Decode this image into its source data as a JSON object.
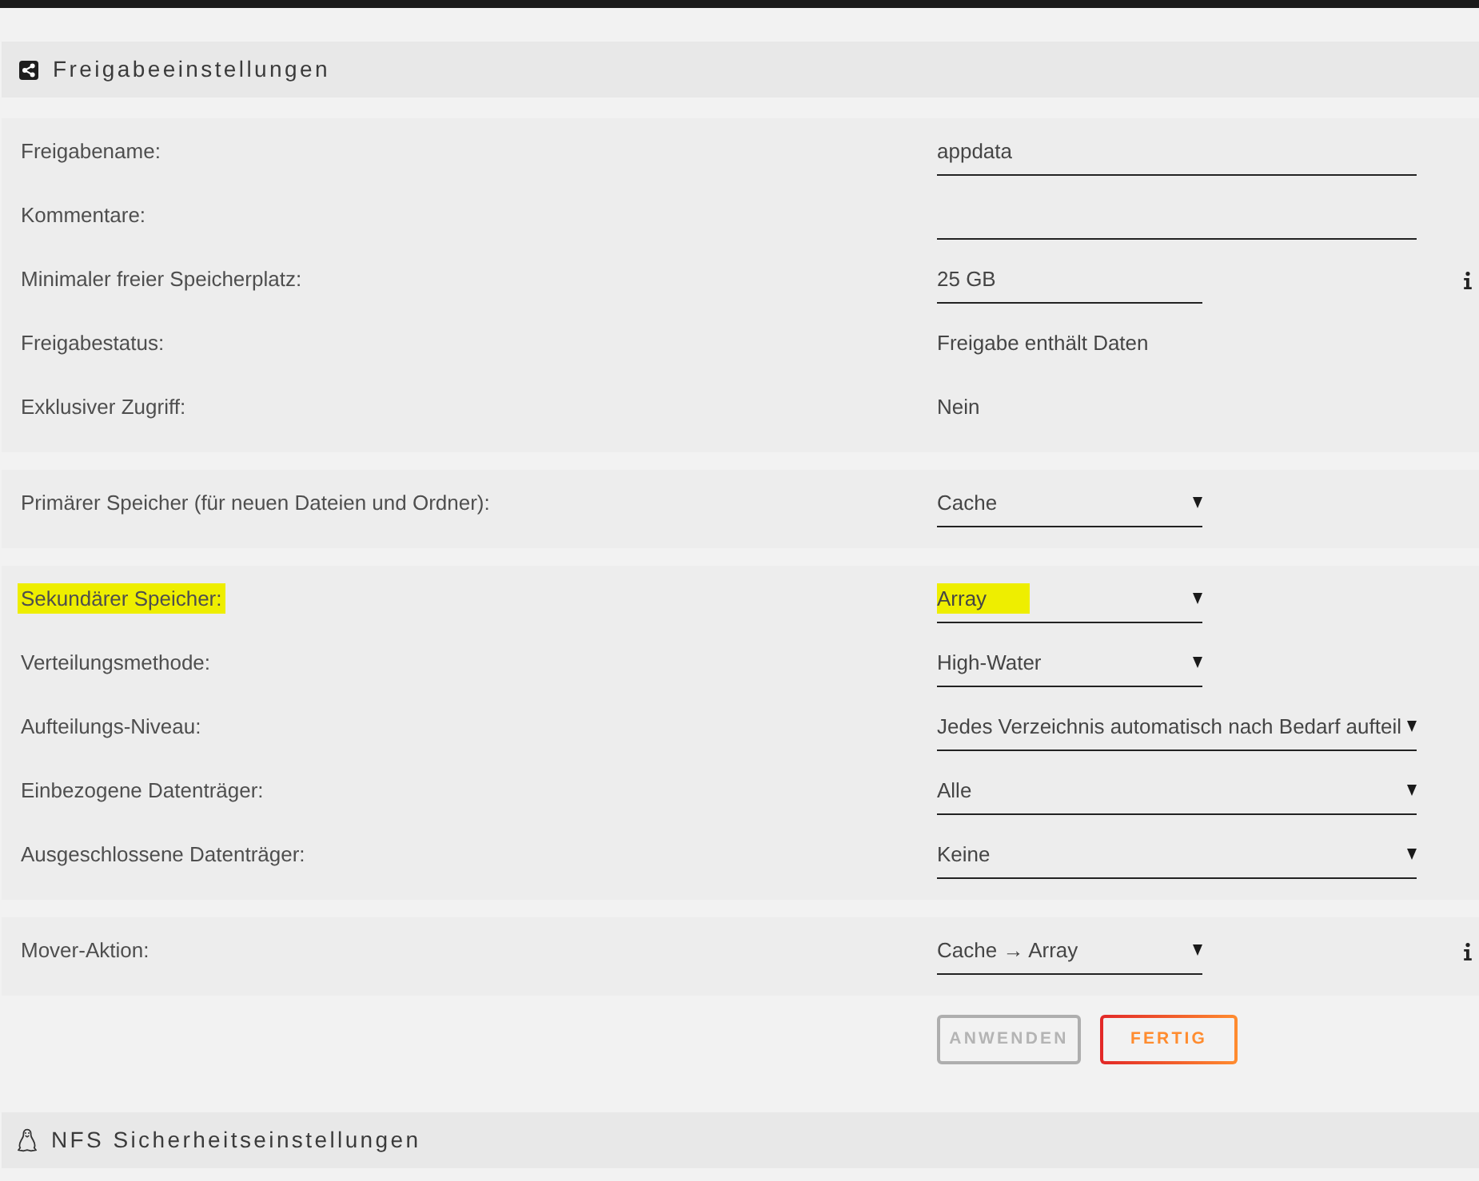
{
  "section": {
    "title": "Freigabeeinstellungen"
  },
  "groups": [
    {
      "rows": [
        {
          "label": "Freigabename:",
          "kind": "input",
          "value": "appdata",
          "wide": true,
          "info": false,
          "highlighted": false
        },
        {
          "label": "Kommentare:",
          "kind": "input",
          "wide": true,
          "info": false,
          "highlighted": false
        },
        {
          "label": "Minimaler freier Speicherplatz:",
          "kind": "input",
          "value": "25 GB",
          "wide": false,
          "info": true,
          "highlighted": false
        },
        {
          "label": "Freigabestatus:",
          "kind": "text",
          "value": "Freigabe enthält Daten",
          "info": false,
          "highlighted": false
        },
        {
          "label": "Exklusiver Zugriff:",
          "kind": "text",
          "value": "Nein",
          "info": false,
          "highlighted": false
        }
      ]
    },
    {
      "rows": [
        {
          "label": "Primärer Speicher (für neuen Dateien und Ordner):",
          "kind": "select",
          "value": "Cache",
          "wide": false,
          "info": false,
          "highlighted": false
        }
      ]
    },
    {
      "rows": [
        {
          "label": "Sekundärer Speicher:",
          "kind": "select",
          "value": "Array",
          "wide": false,
          "info": false,
          "highlighted": true
        },
        {
          "label": "Verteilungsmethode:",
          "kind": "select",
          "value": "High-Water",
          "wide": false,
          "info": false,
          "highlighted": false
        },
        {
          "label": "Aufteilungs-Niveau:",
          "kind": "select",
          "value": "Jedes Verzeichnis automatisch nach Bedarf aufteil",
          "wide": true,
          "info": false,
          "highlighted": false
        },
        {
          "label": "Einbezogene Datenträger:",
          "kind": "select",
          "value": "Alle",
          "wide": true,
          "info": false,
          "highlighted": false
        },
        {
          "label": "Ausgeschlossene Datenträger:",
          "kind": "select",
          "value": "Keine",
          "wide": true,
          "info": false,
          "highlighted": false
        }
      ]
    },
    {
      "rows": [
        {
          "label": "Mover-Aktion:",
          "kind": "select",
          "value": "Cache → Array",
          "wide": false,
          "info": true,
          "highlighted": false
        }
      ]
    }
  ],
  "buttons": [
    {
      "label": "ANWENDEN",
      "disabled": true
    },
    {
      "label": "FERTIG",
      "disabled": false
    }
  ],
  "next_section": {
    "title": "NFS Sicherheitseinstellungen"
  }
}
